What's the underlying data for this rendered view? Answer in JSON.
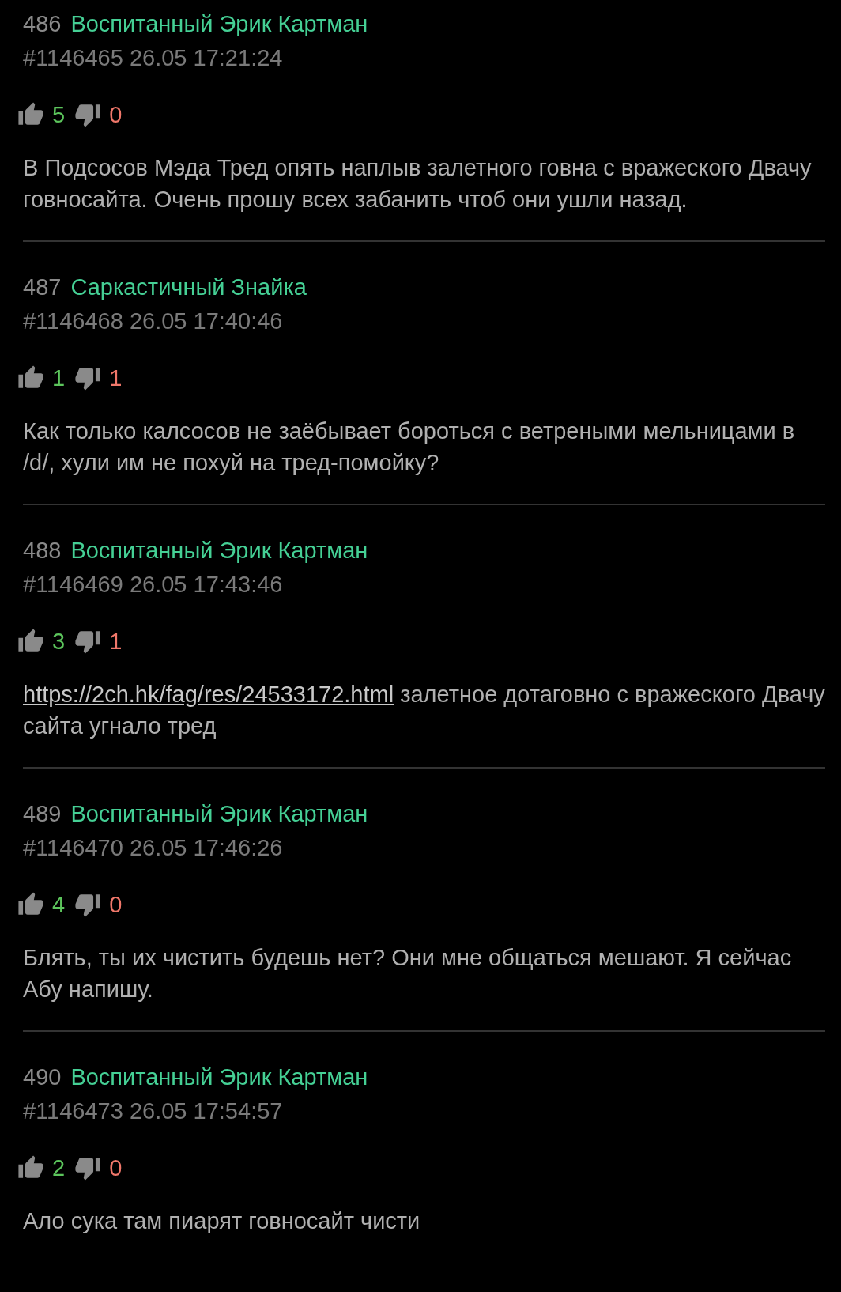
{
  "posts": [
    {
      "number": "486",
      "author": "Воспитанный Эрик Картман",
      "meta": "#1146465 26.05 17:21:24",
      "likes": "5",
      "dislikes": "0",
      "body": [
        {
          "kind": "text",
          "text": "В Подсосов Мэда Тред опять наплыв залетного говна с вражеского Двачу говносайта. Очень прошу всех забанить чтоб они ушли назад."
        }
      ]
    },
    {
      "number": "487",
      "author": "Саркастичный Знайка",
      "meta": "#1146468 26.05 17:40:46",
      "likes": "1",
      "dislikes": "1",
      "body": [
        {
          "kind": "text",
          "text": "Как только калсосов не заёбывает бороться с ветреными мельницами в /d/, хули им не похуй на тред-помойку?"
        }
      ]
    },
    {
      "number": "488",
      "author": "Воспитанный Эрик Картман",
      "meta": "#1146469 26.05 17:43:46",
      "likes": "3",
      "dislikes": "1",
      "body": [
        {
          "kind": "link",
          "text": "https://2ch.hk/fag/res/24533172.html"
        },
        {
          "kind": "text",
          "text": " залетное дотаговно с вражеского Двачу сайта угнало тред"
        }
      ]
    },
    {
      "number": "489",
      "author": "Воспитанный Эрик Картман",
      "meta": "#1146470 26.05 17:46:26",
      "likes": "4",
      "dislikes": "0",
      "body": [
        {
          "kind": "text",
          "text": "Блять, ты их чистить будешь нет? Они мне общаться мешают. Я сейчас Абу напишу."
        }
      ]
    },
    {
      "number": "490",
      "author": "Воспитанный Эрик Картман",
      "meta": "#1146473 26.05 17:54:57",
      "likes": "2",
      "dislikes": "0",
      "body": [
        {
          "kind": "text",
          "text": "Ало сука там пиарят говносайт чисти"
        }
      ]
    }
  ]
}
